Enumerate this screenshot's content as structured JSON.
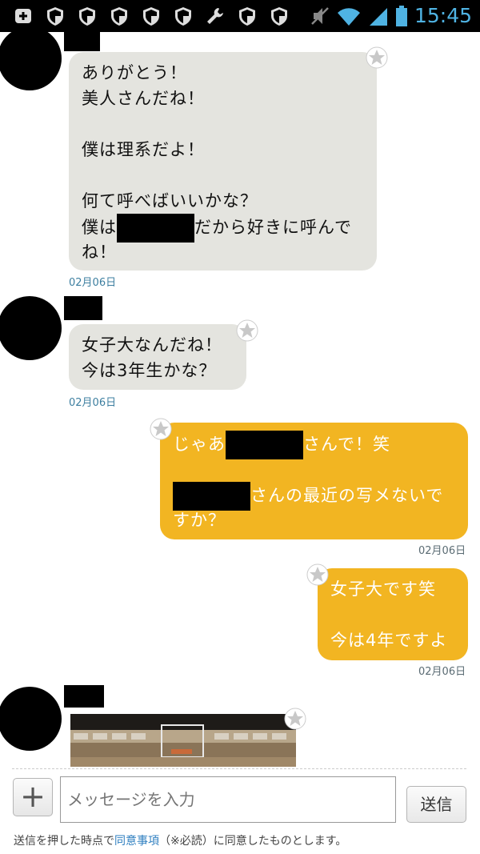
{
  "status_bar": {
    "time": "15:45",
    "icons": [
      "add-box-icon",
      "shield-icon",
      "shield-icon",
      "shield-icon",
      "shield-icon",
      "shield-icon",
      "wrench-icon",
      "shield-icon",
      "shield-icon",
      "mute-icon",
      "wifi-icon",
      "signal-icon",
      "battery-icon"
    ]
  },
  "messages": [
    {
      "direction": "in",
      "lines": [
        "ありがとう！",
        "美人さんだね！",
        "",
        "僕は理系だよ！",
        "",
        "何て呼べばいいかな？",
        "僕は",
        "だから好きに呼んで",
        "ね！"
      ],
      "date": "02月06日"
    },
    {
      "direction": "in",
      "lines": [
        "女子大なんだね！",
        "今は3年生かな？"
      ],
      "date": "02月06日"
    },
    {
      "direction": "out",
      "lines": [
        "じゃあ",
        "さんで！笑",
        "",
        "さんの最近の写メないで",
        "すか？"
      ],
      "date": "02月06日"
    },
    {
      "direction": "out",
      "lines": [
        "女子大です笑",
        "",
        "今は4年ですよ"
      ],
      "date": "02月06日"
    },
    {
      "direction": "in",
      "type": "image"
    }
  ],
  "composer": {
    "placeholder": "メッセージを入力",
    "send_label": "送信",
    "plus_label": "+",
    "notice_before": "送信を押した時点で",
    "notice_link": "同意事項",
    "notice_after": "（※必読）に同意したものとします。"
  },
  "colors": {
    "incoming_bubble": "#e4e4df",
    "outgoing_bubble": "#f2b522",
    "time_accent": "#4fb3e3",
    "link": "#2f7fc0"
  }
}
